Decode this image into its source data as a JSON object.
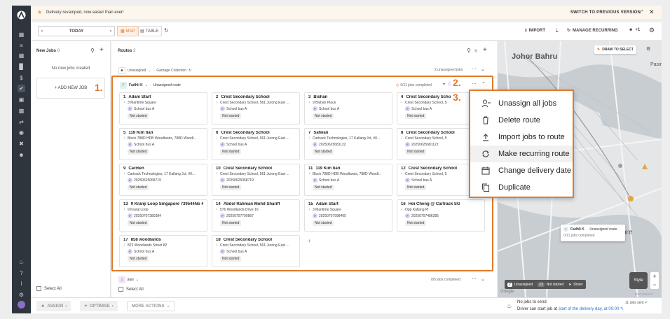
{
  "banner": {
    "message": "Delivery revamped, now easier than ever!",
    "switch_label": "SWITCH TO PREVIOUS VERSION"
  },
  "toolbar": {
    "date_label": "TODAY",
    "map_label": "MAP",
    "table_label": "TABLE",
    "import_label": "IMPORT",
    "manage_recurring_label": "MANAGE RECURRING",
    "users_count": "+1"
  },
  "new_jobs": {
    "title": "New Jobs",
    "count": "0",
    "empty_text": "No new jobs created",
    "add_label": "+ ADD NEW JOB",
    "select_all": "Select All"
  },
  "routes": {
    "title": "Routes",
    "count": "3",
    "top_row": {
      "status": "Unassigned",
      "name": "Garbage Collection",
      "meta": "2 unassigned jobs"
    },
    "selected": {
      "driver": "Fadhli K",
      "status": "Unassigned route",
      "jobs_completed": "0/11 jobs completed",
      "extra": "C"
    },
    "bottom_row": {
      "driver": "jiayi",
      "meta": "0/5 jobs completed",
      "select_all": "Select All"
    },
    "jobs": [
      {
        "n": "1",
        "name": "Adam Start",
        "addr": "3 Maritime Square",
        "vehicle": "School bus A",
        "status": "Not started"
      },
      {
        "n": "2",
        "name": "Crest Secondary School",
        "addr": "Crest Secondary School, 561 Jurong East ...",
        "vehicle": "School bus A",
        "status": "Not started"
      },
      {
        "n": "3",
        "name": "Bishan",
        "addr": "9 Bishan Place",
        "vehicle": "School bus A",
        "status": "Not started"
      },
      {
        "n": "4",
        "name": "Crest Secondary Scho",
        "addr": "Crest Secondary School, 5",
        "vehicle": "School bus A",
        "status": "Not started"
      },
      {
        "n": "5",
        "name": "119 Kim tian",
        "addr": "Block 788D HDB Woodlands, 788D Woodl...",
        "vehicle": "School bus A",
        "status": "Not started"
      },
      {
        "n": "6",
        "name": "Crest Secondary School",
        "addr": "Crest Secondary School, 561 Jurong East ...",
        "vehicle": "School bus A",
        "status": "Not started"
      },
      {
        "n": "7",
        "name": "Safwan",
        "addr": "Cartrack Technologies, 17 Kallang Jct, #0...",
        "vehicle": "20250625681122",
        "status": "Not started"
      },
      {
        "n": "8",
        "name": "Crest Secondary School",
        "addr": "Crest Secondary School, 5",
        "vehicle": "20250625681122",
        "status": "Not started"
      },
      {
        "n": "9",
        "name": "Carmen",
        "addr": "Cartrack Technologies, 17 Kallang Jct, #0...",
        "vehicle": "20250625068719",
        "status": "Not started"
      },
      {
        "n": "10",
        "name": "Crest Secondary School",
        "addr": "Crest Secondary School, 561 Jurong East ...",
        "vehicle": "20250625068719",
        "status": "Not started"
      },
      {
        "n": "11",
        "name": "119 Kim tian",
        "addr": "Block 788D HDB Woodlands, 788D Woodl...",
        "vehicle": "School bus A",
        "status": "Not started"
      },
      {
        "n": "12",
        "name": "Crest Secondary School",
        "addr": "Crest Secondary School, 5",
        "vehicle": "School bus A",
        "status": "Not started"
      },
      {
        "n": "13",
        "name": "9 Kranji Loop Singapore 739544No 4 ...",
        "addr": "9 Kranji Loop",
        "vehicle": "20250707380384",
        "status": "Not started"
      },
      {
        "n": "14",
        "name": "Abdol Rahman Mohd Shariff",
        "addr": "576 Woodlands Drive 16",
        "vehicle": "20250707790867",
        "status": "Not started"
      },
      {
        "n": "15",
        "name": "Adam Start",
        "addr": "3 Maritime Square",
        "vehicle": "20250707998465",
        "status": "Not started"
      },
      {
        "n": "16",
        "name": "Hoi Cheng @ Cartrack SG",
        "addr": "Opp Kallang Pl",
        "vehicle": "20250707486285",
        "status": "Not started"
      },
      {
        "n": "17",
        "name": "858 woodlands",
        "addr": "822 Woodlands Street 82",
        "vehicle": "School bus A",
        "status": "Not started"
      },
      {
        "n": "18",
        "name": "Crest Secondary School",
        "addr": "Crest Secondary School, 561 Jurong East ...",
        "vehicle": "School bus A",
        "status": "Not started"
      }
    ]
  },
  "annotations": {
    "one": "1.",
    "two": "2.",
    "three": "3."
  },
  "menu": {
    "items": [
      "Unassign all jobs",
      "Delete route",
      "Import jobs to route",
      "Make recurring route",
      "Change delivery date",
      "Duplicate"
    ]
  },
  "map": {
    "draw_label": "DRAW TO SELECT",
    "labels": {
      "johor": "Johor Bahru",
      "pasir": "Pasir",
      "ore": "ore"
    },
    "popup": {
      "driver": "Fadhli K",
      "status": "Unassigned route",
      "jobs": "0/11 jobs completed"
    },
    "legend": {
      "unassigned_count": "2",
      "unassigned": "Unassigned",
      "not_started_count": "23",
      "not_started": "Not started",
      "driver": "Driver"
    },
    "style_label": "Style",
    "google": "Google",
    "report": "Report a map error"
  },
  "bottom": {
    "assign": "ASSIGN",
    "optimise": "OPTIMISE",
    "more": "MORE ACTIONS",
    "no_jobs": "No jobs to send",
    "driver_start_prefix": "Driver can start job at",
    "driver_start_link": "start of the delivery day, at 00:00",
    "jobs_sent": "11 jobs sent"
  },
  "colors": {
    "accent": "#e07a2a",
    "nav": "#2f353d",
    "vehicle_dot": "#d8d3ef"
  }
}
